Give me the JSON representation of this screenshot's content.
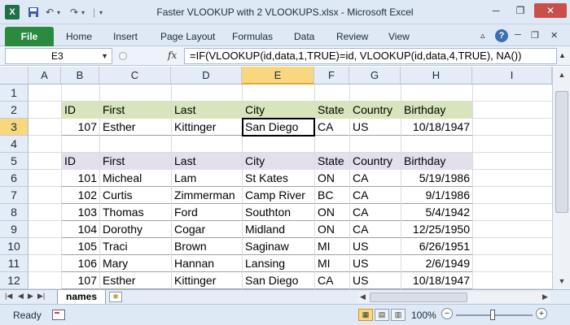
{
  "window": {
    "title": "Faster VLOOKUP with 2 VLOOKUPS.xlsx - Microsoft Excel",
    "app_icon": "X",
    "app_icon_name": "excel-icon"
  },
  "ribbon": {
    "file_label": "File",
    "tabs": [
      "Home",
      "Insert",
      "Page Layout",
      "Formulas",
      "Data",
      "Review",
      "View"
    ]
  },
  "formula_bar": {
    "name_box": "E3",
    "fx_label": "fx",
    "formula": "=IF(VLOOKUP(id,data,1,TRUE)=id, VLOOKUP(id,data,4,TRUE), NA())"
  },
  "grid": {
    "columns": [
      "A",
      "B",
      "C",
      "D",
      "E",
      "F",
      "G",
      "H",
      "I"
    ],
    "selected_column": "E",
    "rows": [
      "1",
      "2",
      "3",
      "4",
      "5",
      "6",
      "7",
      "8",
      "9",
      "10",
      "11",
      "12"
    ],
    "selected_row": "3",
    "lookup_table": {
      "headers": [
        "ID",
        "First",
        "Last",
        "City",
        "State",
        "Country",
        "Birthday"
      ],
      "row": [
        "107",
        "Esther",
        "Kittinger",
        "San Diego",
        "CA",
        "US",
        "10/18/1947"
      ]
    },
    "data_table": {
      "headers": [
        "ID",
        "First",
        "Last",
        "City",
        "State",
        "Country",
        "Birthday"
      ],
      "rows": [
        [
          "101",
          "Micheal",
          "Lam",
          "St Kates",
          "ON",
          "CA",
          "5/19/1986"
        ],
        [
          "102",
          "Curtis",
          "Zimmerman",
          "Camp River",
          "BC",
          "CA",
          "9/1/1986"
        ],
        [
          "103",
          "Thomas",
          "Ford",
          "Southton",
          "ON",
          "CA",
          "5/4/1942"
        ],
        [
          "104",
          "Dorothy",
          "Cogar",
          "Midland",
          "ON",
          "CA",
          "12/25/1950"
        ],
        [
          "105",
          "Traci",
          "Brown",
          "Saginaw",
          "MI",
          "US",
          "6/26/1951"
        ],
        [
          "106",
          "Mary",
          "Hannan",
          "Lansing",
          "MI",
          "US",
          "2/6/1949"
        ],
        [
          "107",
          "Esther",
          "Kittinger",
          "San Diego",
          "CA",
          "US",
          "10/18/1947"
        ]
      ]
    }
  },
  "sheets": {
    "active": "names"
  },
  "status_bar": {
    "ready": "Ready",
    "zoom": "100%"
  },
  "colors": {
    "header_green": "#d8e4bc",
    "header_purple": "#e4dfec",
    "selected_header": "#f9d77e",
    "file_tab": "#2a8a3e"
  }
}
